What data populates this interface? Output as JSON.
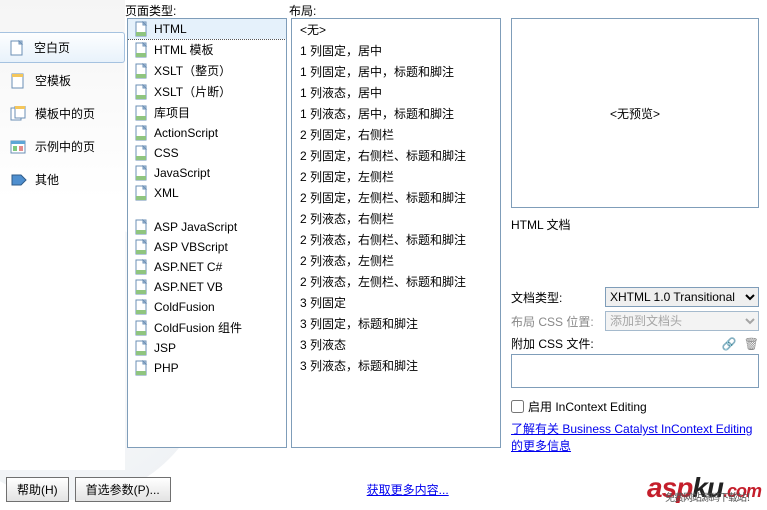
{
  "sidebar": {
    "items": [
      {
        "label": "空白页"
      },
      {
        "label": "空模板"
      },
      {
        "label": "模板中的页"
      },
      {
        "label": "示例中的页"
      },
      {
        "label": "其他"
      }
    ]
  },
  "col1": {
    "heading": "页面类型:",
    "group1": [
      {
        "label": "HTML"
      },
      {
        "label": "HTML 模板"
      },
      {
        "label": "XSLT（整页）"
      },
      {
        "label": "XSLT（片断）"
      },
      {
        "label": "库项目"
      },
      {
        "label": "ActionScript"
      },
      {
        "label": "CSS"
      },
      {
        "label": "JavaScript"
      },
      {
        "label": "XML"
      }
    ],
    "group2": [
      {
        "label": "ASP JavaScript"
      },
      {
        "label": "ASP VBScript"
      },
      {
        "label": "ASP.NET C#"
      },
      {
        "label": "ASP.NET VB"
      },
      {
        "label": "ColdFusion"
      },
      {
        "label": "ColdFusion 组件"
      },
      {
        "label": "JSP"
      },
      {
        "label": "PHP"
      }
    ]
  },
  "col2": {
    "heading": "布局:",
    "items": [
      "<无>",
      "1 列固定，居中",
      "1 列固定，居中，标题和脚注",
      "1 列液态，居中",
      "1 列液态，居中，标题和脚注",
      "2 列固定，右侧栏",
      "2 列固定，右侧栏、标题和脚注",
      "2 列固定，左侧栏",
      "2 列固定，左侧栏、标题和脚注",
      "2 列液态，右侧栏",
      "2 列液态，右侧栏、标题和脚注",
      "2 列液态，左侧栏",
      "2 列液态，左侧栏、标题和脚注",
      "3 列固定",
      "3 列固定，标题和脚注",
      "3 列液态",
      "3 列液态，标题和脚注"
    ]
  },
  "right": {
    "preview_text": "<无预览>",
    "doc_text": "HTML 文档",
    "doctype_label": "文档类型:",
    "doctype_value": "XHTML 1.0 Transitional",
    "csspos_label": "布局 CSS 位置:",
    "csspos_value": "添加到文档头",
    "attach_label": "附加 CSS 文件:",
    "incontext_label": "启用 InContext Editing",
    "link_text": "了解有关 Business Catalyst InContext Editing 的更多信息"
  },
  "bottom": {
    "help": "帮助(H)",
    "prefs": "首选参数(P)...",
    "get_more": "获取更多内容..."
  },
  "watermark": {
    "a": "asp",
    "b": "ku",
    "c": ".com",
    "sub": "免费网站源码下载站！"
  }
}
